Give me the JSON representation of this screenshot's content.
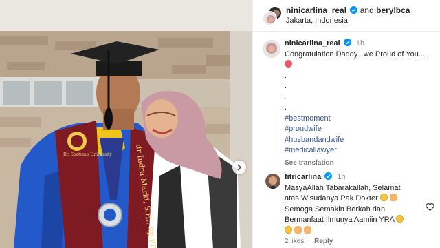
{
  "header": {
    "user1": "ninicarlina_real",
    "connector": "and",
    "user2": "berylbca",
    "location": "Jakarta, Indonesia"
  },
  "caption": {
    "username": "ninicarlina_real",
    "time": "1h",
    "text": "Congratulation Daddy...we Proud of You.....",
    "dots": [
      ".",
      ".",
      ".",
      "."
    ],
    "hashtags": [
      "#bestmoment",
      "#proudwife",
      "#husbandandwife",
      "#medicallawyer"
    ],
    "see_translation": "See translation"
  },
  "comment": {
    "username": "fitricarlina",
    "time": "1h",
    "line1": "MasyaAllah Tabarakallah, Selamat",
    "line2": "atas Wisudanya Pak Dokter",
    "line3": "Semoga Semakin Berkah dan",
    "line4": "Bermanfaat Ilmunya Aamiin YRA",
    "likes": "2 likes",
    "reply": "Reply"
  },
  "photo": {
    "sash_text": "dr Indra Marki, S.H., Sp.PD, F",
    "university_text": "Dr. Soetomo University"
  },
  "colors": {
    "accent": "#385898",
    "verified": "#0095f6",
    "gown": "#2459c9",
    "sash": "#7d1a22"
  }
}
